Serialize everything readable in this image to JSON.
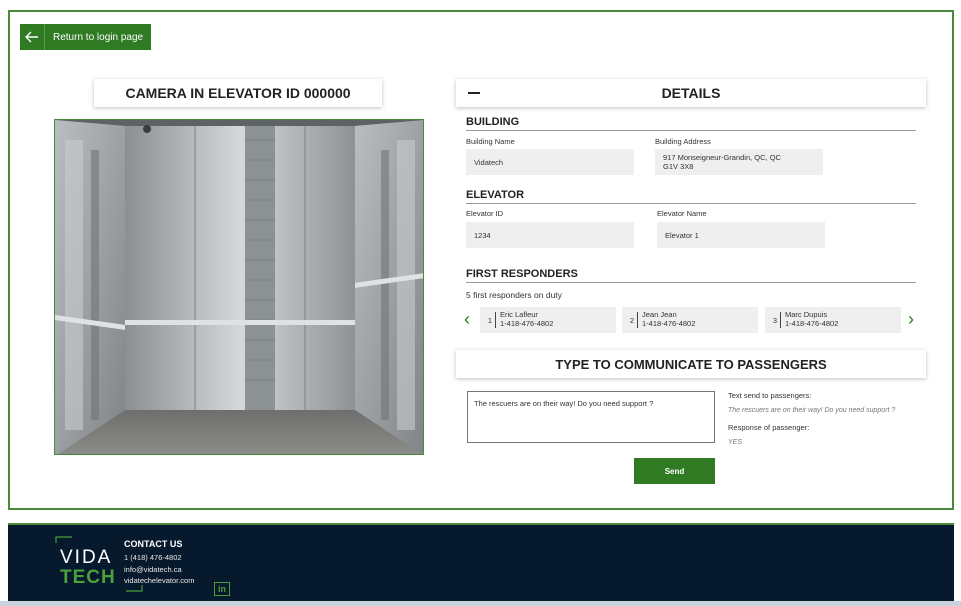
{
  "nav": {
    "back_label": "Return to login page"
  },
  "camera": {
    "title": "CAMERA IN ELEVATOR ID 000000"
  },
  "details": {
    "title": "DETAILS",
    "building": {
      "heading": "BUILDING",
      "name_label": "Building Name",
      "name_value": "Vidatech",
      "address_label": "Building Address",
      "address_line1": "917 Monseigneur-Grandin, QC, QC",
      "address_line2": "G1V 3X8"
    },
    "elevator": {
      "heading": "ELEVATOR",
      "id_label": "Elevator ID",
      "id_value": "1234",
      "name_label": "Elevator Name",
      "name_value": "Elevator 1"
    },
    "responders": {
      "heading": "FIRST RESPONDERS",
      "note": "5 first responders on duty",
      "items": [
        {
          "num": "1",
          "name": "Eric Lafleur",
          "phone": "1-418-476-4802"
        },
        {
          "num": "2",
          "name": "Jean Jean",
          "phone": "1-418-476-4802"
        },
        {
          "num": "3",
          "name": "Marc Dupuis",
          "phone": "1-418-476-4802"
        }
      ]
    }
  },
  "communicate": {
    "title": "TYPE TO COMMUNICATE TO PASSENGERS",
    "message": "The rescuers are on their way! Do you need support ?",
    "sent_label": "Text send to passengers:",
    "sent_value": "The rescuers are on their way! Do you need support ?",
    "response_label": "Response of passenger:",
    "response_value": "YES",
    "send_label": "Send"
  },
  "footer": {
    "logo_top": "VIDA",
    "logo_bottom": "TECH",
    "heading": "CONTACT US",
    "phone": "1 (418) 476-4802",
    "email": "info@vidatech.ca",
    "website": "vidatechelevator.com",
    "linkedin": "in"
  },
  "colors": {
    "accent": "#2f7a22",
    "footer_bg": "#07192d"
  }
}
